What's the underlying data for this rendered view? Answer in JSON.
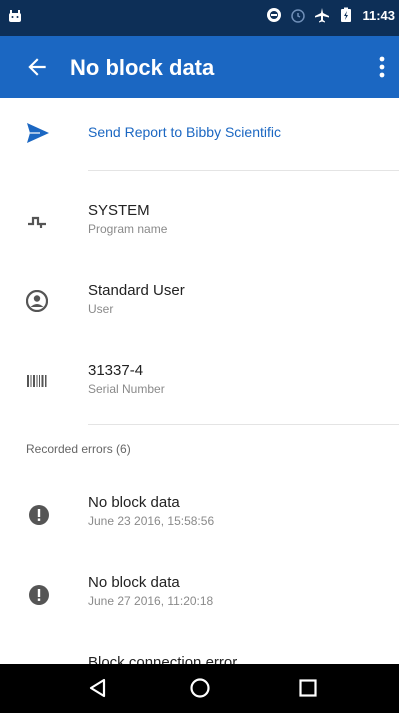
{
  "status_bar": {
    "time": "11:43",
    "icons": [
      "android-icon",
      "sync-icon",
      "alarm-icon",
      "airplane-icon",
      "battery-icon"
    ]
  },
  "app_bar": {
    "title": "No block data",
    "back_icon": "arrow-left-icon",
    "menu_icon": "more-vert-icon"
  },
  "send_report": {
    "label": "Send Report to Bibby Scientific",
    "icon": "send-icon"
  },
  "info": [
    {
      "value": "SYSTEM",
      "label": "Program name",
      "icon": "program-icon"
    },
    {
      "value": "Standard User",
      "label": "User",
      "icon": "account-icon"
    },
    {
      "value": "31337-4",
      "label": "Serial Number",
      "icon": "barcode-icon"
    }
  ],
  "errors": {
    "header": "Recorded errors (6)",
    "items": [
      {
        "title": "No block data",
        "timestamp": "June 23 2016, 15:58:56"
      },
      {
        "title": "No block data",
        "timestamp": "June 27 2016, 11:20:18"
      },
      {
        "title": "Block connection error",
        "timestamp": ""
      }
    ]
  },
  "nav_bar": {
    "buttons": [
      "back-triangle-icon",
      "home-circle-icon",
      "recents-square-icon"
    ]
  },
  "colors": {
    "status_bar": "#0d2f57",
    "app_bar": "#1b67c2",
    "accent": "#1b67c2",
    "icon_grey": "#555555"
  }
}
